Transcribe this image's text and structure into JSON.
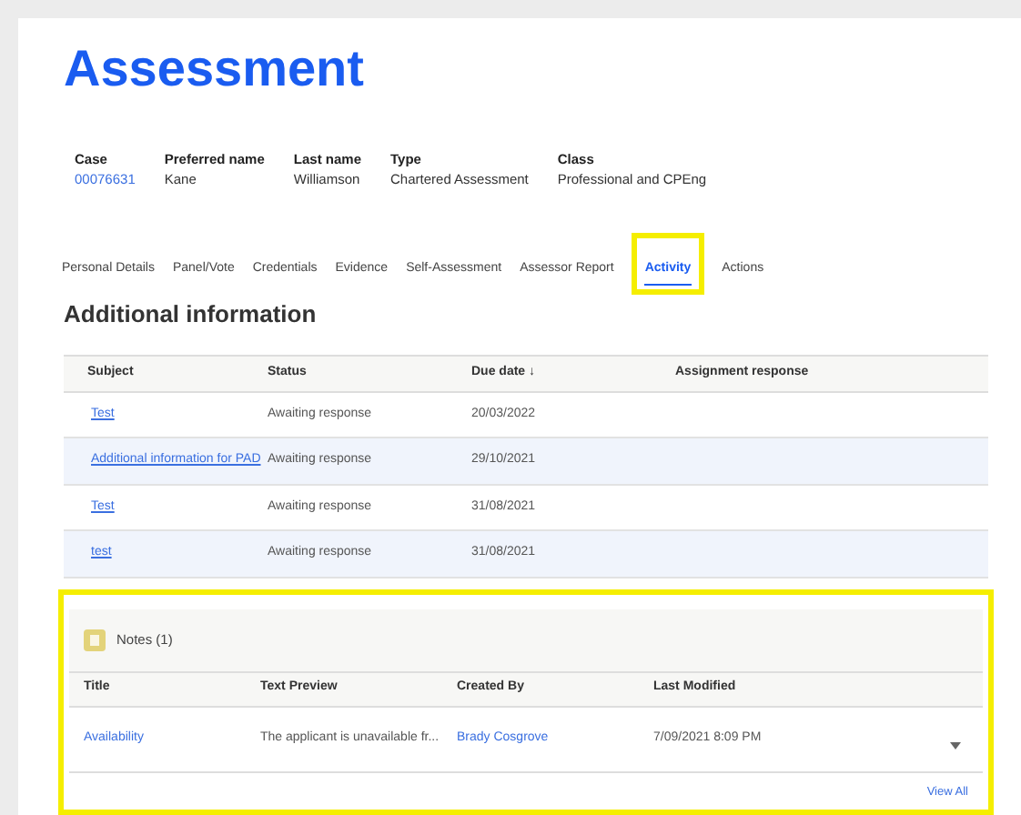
{
  "title": "Assessment",
  "case_fields": [
    {
      "label": "Case",
      "value": "00076631",
      "kind": "link"
    },
    {
      "label": "Preferred name",
      "value": "Kane",
      "kind": "text"
    },
    {
      "label": "Last name",
      "value": "Williamson",
      "kind": "text"
    },
    {
      "label": "Type",
      "value": "Chartered Assessment",
      "kind": "text"
    },
    {
      "label": "Class",
      "value": "Professional and CPEng",
      "kind": "text"
    }
  ],
  "tabs": [
    {
      "label": "Personal Details",
      "selected": false,
      "highlighted": false
    },
    {
      "label": "Panel/Vote",
      "selected": false,
      "highlighted": false
    },
    {
      "label": "Credentials",
      "selected": false,
      "highlighted": false
    },
    {
      "label": "Evidence",
      "selected": false,
      "highlighted": false
    },
    {
      "label": "Self-Assessment",
      "selected": false,
      "highlighted": false
    },
    {
      "label": "Assessor Report",
      "selected": false,
      "highlighted": false
    },
    {
      "label": "Activity",
      "selected": true,
      "highlighted": true
    },
    {
      "label": "Actions",
      "selected": false,
      "highlighted": false
    }
  ],
  "section_title": "Additional information",
  "table": {
    "columns": [
      "Subject",
      "Status",
      "Due date ↓",
      "Assignment response"
    ],
    "rows": [
      {
        "subject": "Test",
        "status": "Awaiting response",
        "due_date": "20/03/2022"
      },
      {
        "subject": "Additional information for PAD",
        "status": "Awaiting response",
        "due_date": "29/10/2021"
      },
      {
        "subject": "Test",
        "status": "Awaiting response",
        "due_date": "31/08/2021"
      },
      {
        "subject": "test",
        "status": "Awaiting response",
        "due_date": "31/08/2021"
      }
    ]
  },
  "notes": {
    "highlighted": true,
    "title": "Notes (1)",
    "columns": [
      "Title",
      "Text Preview",
      "Created By",
      "Last Modified"
    ],
    "rows": [
      {
        "title": "Availability",
        "preview": "The applicant is unavailable fr...",
        "created_by": "Brady Cosgrove",
        "last_modified": "7/09/2021 8:09 PM"
      }
    ],
    "view_all": "View All"
  }
}
